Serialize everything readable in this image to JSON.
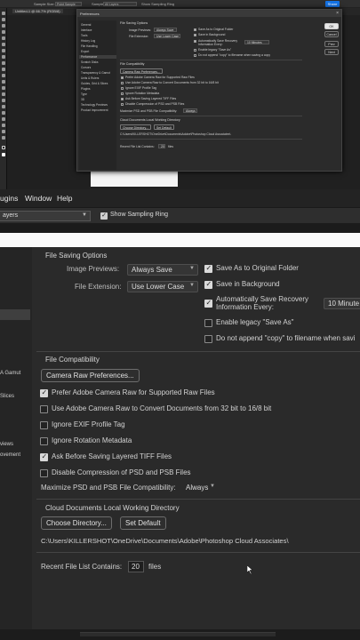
{
  "top": {
    "option_bar": {
      "sample_size_label": "Sample Size:",
      "sample_size_value": "Point Sample",
      "sample_label": "Sample:",
      "sample_value": "All Layers",
      "show_ring": "Show Sampling Ring",
      "share": "Share"
    },
    "doc_tab": "Untitled-1 @ 66.7% (RGB/8)",
    "mini_dialog": {
      "title": "Preferences",
      "close": "×",
      "sidebar": [
        "General",
        "Interface",
        "Tools",
        "History Log",
        "File Handling",
        "Export",
        "Performance",
        "Scratch Disks",
        "Cursors",
        "Transparency & Gamut",
        "Units & Rulers",
        "Guides, Grid & Slices",
        "Plugins",
        "Type",
        "3D",
        "Technology Previews",
        "Product Improvement"
      ],
      "file_saving_options": "File Saving Options",
      "image_previews_label": "Image Previews:",
      "image_previews_value": "Always Save",
      "file_extension_label": "File Extension:",
      "file_extension_value": "Use Lower Case",
      "save_as_original": "Save As to Original Folder",
      "save_in_background": "Save in Background",
      "auto_save": "Automatically Save Recovery Information Every:",
      "auto_save_value": "10 Minutes",
      "legacy": "Enable legacy \"Save As\"",
      "no_copy": "Do not append \"copy\" to filename when saving a copy",
      "file_compat": "File Compatibility",
      "camera_raw_prefs": "Camera Raw Preferences...",
      "prefer_camera_raw": "Prefer Adobe Camera Raw for Supported Raw Files",
      "use_camera_raw_convert": "Use Adobe Camera Raw to Convert Documents from 32 bit to 16/8 bit",
      "ignore_exif": "Ignore EXIF Profile Tag",
      "ignore_rotation": "Ignore Rotation Metadata",
      "ask_tiff": "Ask Before Saving Layered TIFF Files",
      "disable_compression": "Disable Compression of PSD and PSB Files",
      "maximize_label": "Maximize PSD and PSB File Compatibility:",
      "maximize_value": "Always",
      "cloud_title": "Cloud Documents Local Working Directory",
      "choose_dir": "Choose Directory...",
      "set_default": "Set Default",
      "path": "C:\\Users\\KILLERSHOT\\OneDrive\\Documents\\Adobe\\Photoshop Cloud Associates\\",
      "recent_label": "Recent File List Contains:",
      "recent_value": "20",
      "recent_unit": "files",
      "ok": "OK",
      "cancel": "Cancel",
      "prev": "Prev",
      "next": "Next"
    },
    "menubar": [
      "ugins",
      "Window",
      "Help"
    ],
    "sample_value": "ayers",
    "show_ring": "Show Sampling Ring"
  },
  "side": {
    "items": [
      "A Gamut",
      "Slices",
      "views",
      "ovement"
    ]
  },
  "dialog": {
    "file_saving_options": "File Saving Options",
    "image_previews_label": "Image Previews:",
    "image_previews_value": "Always Save",
    "file_extension_label": "File Extension:",
    "file_extension_value": "Use Lower Case",
    "save_as_original": "Save As to Original Folder",
    "save_in_background": "Save in Background",
    "auto_save_line1": "Automatically Save Recovery",
    "auto_save_line2": "Information Every:",
    "auto_save_value": "10 Minute",
    "legacy": "Enable legacy \"Save As\"",
    "no_copy": "Do not append \"copy\" to filename when savi",
    "file_compat": "File Compatibility",
    "camera_raw_prefs": "Camera Raw Preferences...",
    "prefer_camera_raw": "Prefer Adobe Camera Raw for Supported Raw Files",
    "use_camera_raw_convert": "Use Adobe Camera Raw to Convert Documents from 32 bit to 16/8 bit",
    "ignore_exif": "Ignore EXIF Profile Tag",
    "ignore_rotation": "Ignore Rotation Metadata",
    "ask_tiff": "Ask Before Saving Layered TIFF Files",
    "disable_compression": "Disable Compression of PSD and PSB Files",
    "maximize_label": "Maximize PSD and PSB File Compatibility:",
    "maximize_value": "Always",
    "cloud_title": "Cloud Documents Local Working Directory",
    "choose_dir": "Choose Directory...",
    "set_default": "Set Default",
    "path": "C:\\Users\\KILLERSHOT\\OneDrive\\Documents\\Adobe\\Photoshop Cloud Associates\\",
    "recent_label": "Recent File List Contains:",
    "recent_value": "20",
    "recent_unit": "files"
  },
  "checkbox_state": {
    "save_as_original": true,
    "save_in_background": true,
    "auto_save": true,
    "legacy": false,
    "no_copy": false,
    "prefer_camera_raw": true,
    "use_camera_raw_convert": false,
    "ignore_exif": false,
    "ignore_rotation": false,
    "ask_tiff": true,
    "disable_compression": false
  },
  "colors": {
    "accent": "#1473e6",
    "dialog_bg": "#2a2a2a",
    "sidebar_bg": "#252525"
  }
}
